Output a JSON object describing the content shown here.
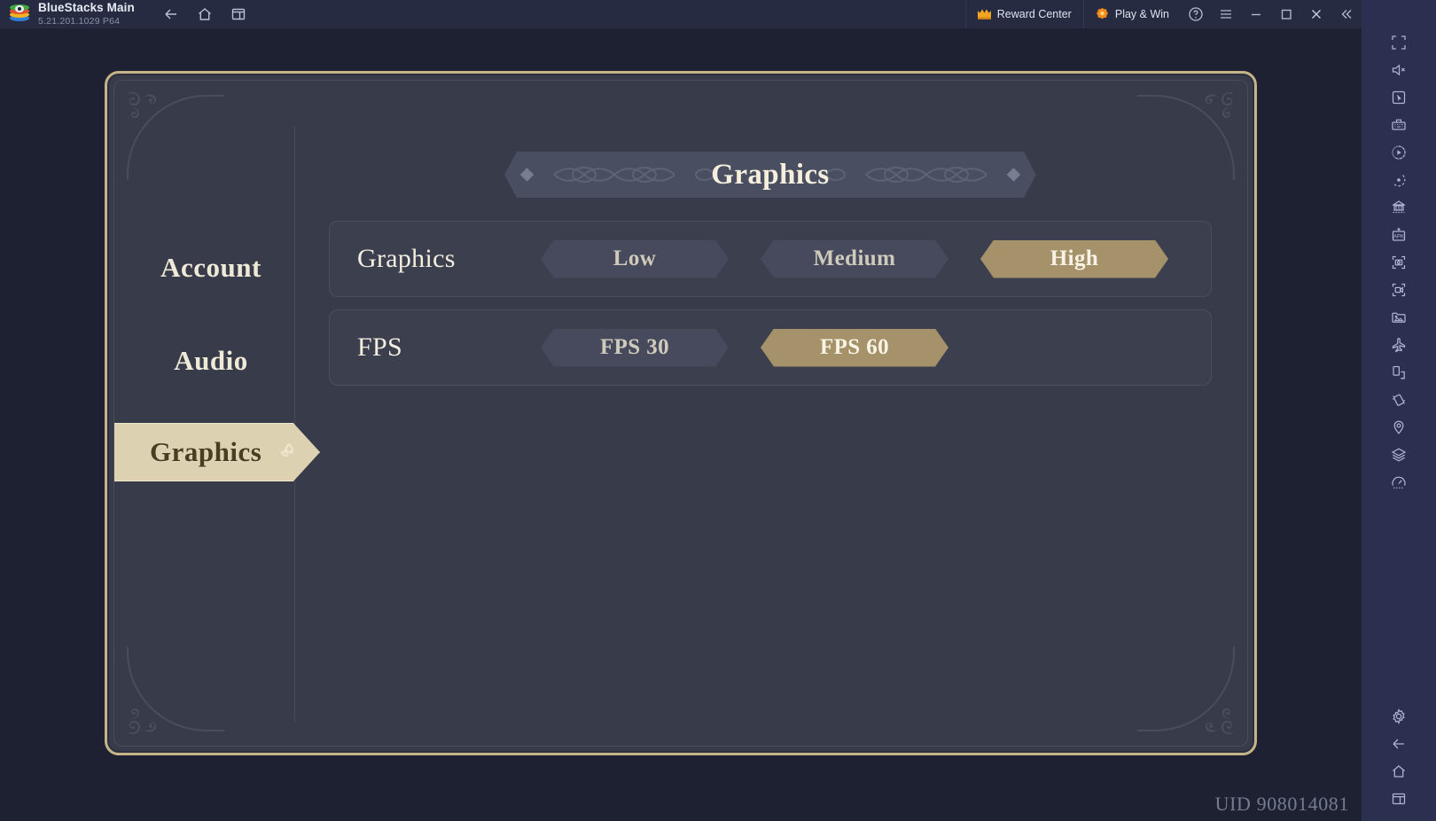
{
  "titlebar": {
    "app_name": "BlueStacks Main",
    "version": "5.21.201.1029  P64",
    "logo_icon": "bluestacks-logo-icon",
    "nav": [
      {
        "name": "back",
        "label": "Back",
        "icon": "arrow-left-icon"
      },
      {
        "name": "home",
        "label": "Home",
        "icon": "home-icon"
      },
      {
        "name": "instances",
        "label": "Multi-instance",
        "icon": "windows-stack-icon"
      }
    ],
    "reward_center": {
      "label": "Reward Center",
      "icon": "crown-icon"
    },
    "play_and_win": {
      "label": "Play & Win",
      "icon": "orange-gem-icon"
    },
    "controls": [
      {
        "name": "help",
        "label": "Help",
        "icon": "question-circle-icon"
      },
      {
        "name": "menu",
        "label": "Menu",
        "icon": "hamburger-icon"
      },
      {
        "name": "minimize",
        "label": "Minimize",
        "icon": "minimize-icon"
      },
      {
        "name": "maximize",
        "label": "Maximize",
        "icon": "maximize-icon"
      },
      {
        "name": "close",
        "label": "Close",
        "icon": "close-icon"
      },
      {
        "name": "collapse-sidebar",
        "label": "Collapse sidebar",
        "icon": "double-chevron-left-icon"
      }
    ]
  },
  "sidebar": {
    "tools": [
      {
        "name": "fullscreen",
        "label": "Full screen",
        "icon": "fullscreen-icon"
      },
      {
        "name": "mute",
        "label": "Mute",
        "icon": "speaker-mute-icon"
      },
      {
        "name": "game-controls",
        "label": "Game controls",
        "icon": "cursor-box-icon"
      },
      {
        "name": "keyboard-controls",
        "label": "Keymapping",
        "icon": "keyboard-icon"
      },
      {
        "name": "macro-recorder",
        "label": "Macro recorder",
        "icon": "play-record-icon"
      },
      {
        "name": "script",
        "label": "Script",
        "icon": "dot-record-icon"
      },
      {
        "name": "multi-instance-sync",
        "label": "Multi-instance sync",
        "icon": "sync-icon"
      },
      {
        "name": "install-apk",
        "label": "Install APK",
        "icon": "apk-plus-icon"
      },
      {
        "name": "screenshot",
        "label": "Screenshot",
        "icon": "camera-icon"
      },
      {
        "name": "record-screen",
        "label": "Record screen",
        "icon": "video-camera-icon"
      },
      {
        "name": "media-manager",
        "label": "Media manager",
        "icon": "photo-folder-icon"
      },
      {
        "name": "eco-mode",
        "label": "Eco mode",
        "icon": "airplane-icon"
      },
      {
        "name": "rotate",
        "label": "Rotate",
        "icon": "rotate-device-icon"
      },
      {
        "name": "shake",
        "label": "Shake",
        "icon": "shake-device-icon"
      },
      {
        "name": "location",
        "label": "Location",
        "icon": "location-pin-icon"
      },
      {
        "name": "layers",
        "label": "Layers",
        "icon": "layers-icon"
      },
      {
        "name": "performance",
        "label": "Performance",
        "icon": "gauge-icon"
      }
    ],
    "bottom": [
      {
        "name": "settings",
        "label": "Settings",
        "icon": "gear-icon"
      },
      {
        "name": "android-back",
        "label": "Back",
        "icon": "arrow-left-icon"
      },
      {
        "name": "android-home",
        "label": "Home",
        "icon": "home-icon"
      },
      {
        "name": "android-recents",
        "label": "Recent apps",
        "icon": "recents-icon"
      }
    ]
  },
  "game": {
    "header": {
      "title": "Graphics",
      "ornament_icon": "filigree-ornament-icon",
      "diamond_icon": "diamond-icon"
    },
    "nav_items": [
      {
        "label": "Account",
        "active": false
      },
      {
        "label": "Audio",
        "active": false
      },
      {
        "label": "Graphics",
        "active": true
      }
    ],
    "settings": [
      {
        "label": "Graphics",
        "options": [
          {
            "label": "Low",
            "selected": false
          },
          {
            "label": "Medium",
            "selected": false
          },
          {
            "label": "High",
            "selected": true
          }
        ]
      },
      {
        "label": "FPS",
        "options": [
          {
            "label": "FPS 30",
            "selected": false
          },
          {
            "label": "FPS 60",
            "selected": true
          }
        ]
      }
    ],
    "uid": "UID 908014081",
    "colors": {
      "frame_gold": "#c5b488",
      "panel_bg": "#383b49",
      "selected_gold": "#a5926a",
      "active_tab_bg": "#dcd2b2",
      "text_cream": "#f3eee0"
    }
  }
}
